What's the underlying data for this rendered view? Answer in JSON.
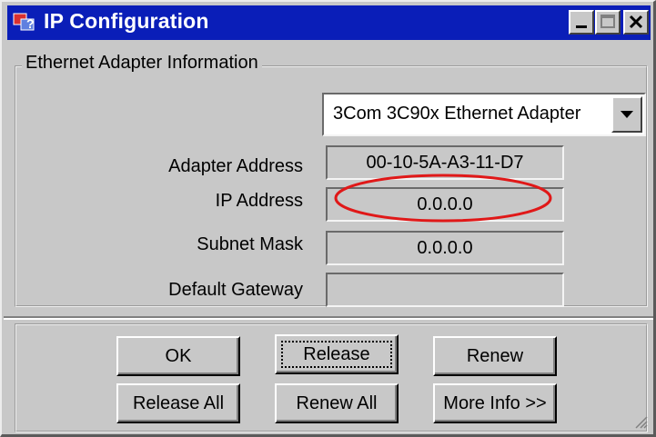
{
  "window": {
    "title": "IP Configuration",
    "icon": "network-config-icon",
    "controls": [
      "minimize-icon",
      "maximize-icon",
      "close-icon"
    ]
  },
  "adapter_group": {
    "label": "Ethernet  Adapter Information",
    "adapter_selected": "3Com 3C90x Ethernet Adapter",
    "fields": [
      {
        "label": "Adapter Address",
        "value": "00-10-5A-A3-11-D7"
      },
      {
        "label": "IP Address",
        "value": "0.0.0.0"
      },
      {
        "label": "Subnet Mask",
        "value": "0.0.0.0"
      },
      {
        "label": "Default Gateway",
        "value": ""
      }
    ]
  },
  "buttons": {
    "ok": "OK",
    "release": "Release",
    "renew": "Renew",
    "release_all": "Release All",
    "renew_all": "Renew All",
    "more_info": "More Info >>"
  },
  "colors": {
    "titlebar": "#0a1eb8",
    "face": "#c8c8c8",
    "annotation": "#e01818"
  }
}
